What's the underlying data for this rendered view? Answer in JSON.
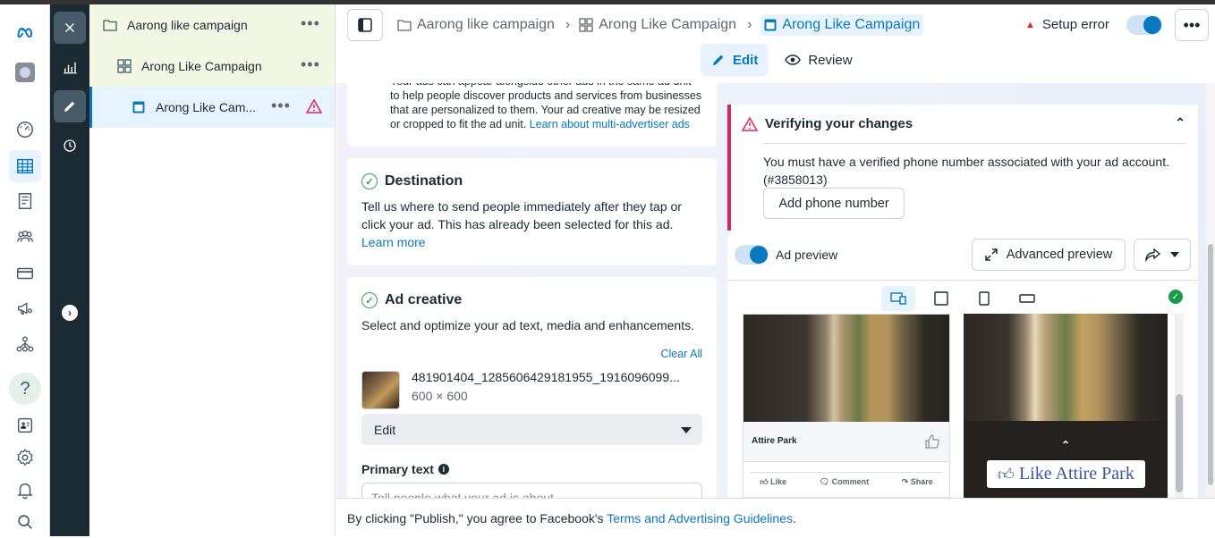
{
  "tree": {
    "campaign": "Aarong like campaign",
    "adset": "Arong Like Campaign",
    "ad": "Arong Like Cam..."
  },
  "header": {
    "breadcrumbs": [
      "Aarong like campaign",
      "Arong Like Campaign",
      "Arong Like Campaign"
    ],
    "setup_error": "Setup error",
    "tabs": {
      "edit": "Edit",
      "review": "Review"
    }
  },
  "multi_advertiser": {
    "text": "Your ads can appear alongside other ads in the same ad unit to help people discover products and services from businesses that are personalized to them. Your ad creative may be resized or cropped to fit the ad unit.",
    "link": "Learn about multi-advertiser ads"
  },
  "destination": {
    "title": "Destination",
    "text": "Tell us where to send people immediately after they tap or click your ad. This has already been selected for this ad.",
    "link": "Learn more"
  },
  "creative": {
    "title": "Ad creative",
    "subtitle": "Select and optimize your ad text, media and enhancements.",
    "clear_all": "Clear All",
    "filename": "481901404_1285606429181955_1916096099...",
    "dimensions": "600 × 600",
    "edit_label": "Edit",
    "primary_label": "Primary text",
    "primary_placeholder": "Tell people what your ad is about"
  },
  "verify": {
    "title": "Verifying your changes",
    "message": "You must have a verified phone number associated with your ad account. (#3858013)",
    "button": "Add phone number"
  },
  "preview": {
    "label": "Ad preview",
    "advanced": "Advanced preview",
    "page_name": "Attire Park",
    "actions": {
      "like": "Like",
      "comment": "Comment",
      "share": "Share"
    },
    "story_cta": "Like Attire Park"
  },
  "footer": {
    "text": "By clicking \"Publish,\" you agree to Facebook's",
    "link": "Terms and Advertising Guidelines",
    "end": "."
  },
  "colors": {
    "accent": "#0a78be",
    "error": "#e0245e",
    "success": "#31a24c"
  }
}
